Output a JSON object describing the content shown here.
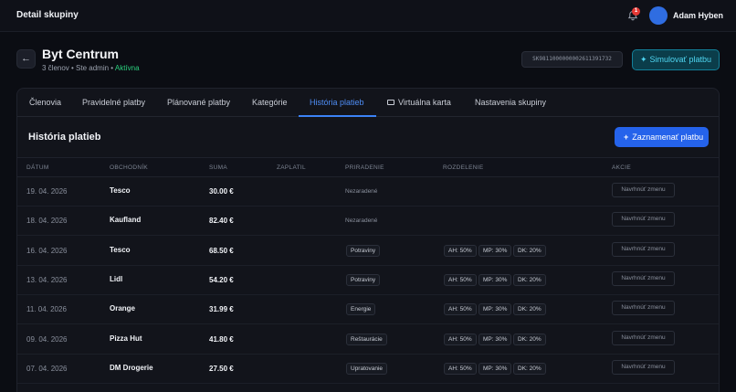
{
  "topbar": {
    "title": "Detail skupiny",
    "notification_count": "1",
    "user_name": "Adam Hyben"
  },
  "group": {
    "name": "Byt Centrum",
    "members": "3 členov • Ste admin • ",
    "status": "Aktívna",
    "iban": "SK9811000000002611391732",
    "simulate_label": "Simulovať platbu"
  },
  "tabs": [
    {
      "label": "Členovia"
    },
    {
      "label": "Pravidelné platby"
    },
    {
      "label": "Plánované platby"
    },
    {
      "label": "Kategórie"
    },
    {
      "label": "História platieb"
    },
    {
      "label": "Virtuálna karta"
    },
    {
      "label": "Nastavenia skupiny"
    }
  ],
  "section": {
    "title": "História platieb",
    "record_button": "Zaznamenať platbu"
  },
  "table": {
    "headers": [
      "DÁTUM",
      "OBCHODNÍK",
      "SUMA",
      "ZAPLATIL",
      "PRIRADENIE",
      "ROZDELENIE",
      "AKCIE"
    ],
    "action_label": "Navrhnúť zmenu",
    "rows": [
      {
        "date": "19. 04. 2026",
        "merchant": "Tesco",
        "amount": "30.00 €",
        "category": "Nezaradené",
        "splits": []
      },
      {
        "date": "18. 04. 2026",
        "merchant": "Kaufland",
        "amount": "82.40 €",
        "category": "Nezaradené",
        "splits": []
      },
      {
        "date": "16. 04. 2026",
        "merchant": "Tesco",
        "amount": "68.50 €",
        "category": "Potraviny",
        "splits": [
          "AH: 50%",
          "MP: 30%",
          "DK: 20%"
        ]
      },
      {
        "date": "13. 04. 2026",
        "merchant": "Lidl",
        "amount": "54.20 €",
        "category": "Potraviny",
        "splits": [
          "AH: 50%",
          "MP: 30%",
          "DK: 20%"
        ]
      },
      {
        "date": "11. 04. 2026",
        "merchant": "Orange",
        "amount": "31.99 €",
        "category": "Energie",
        "splits": [
          "AH: 50%",
          "MP: 30%",
          "DK: 20%"
        ]
      },
      {
        "date": "09. 04. 2026",
        "merchant": "Pizza Hut",
        "amount": "41.80 €",
        "category": "Reštaurácie",
        "splits": [
          "AH: 50%",
          "MP: 30%",
          "DK: 20%"
        ]
      },
      {
        "date": "07. 04. 2026",
        "merchant": "DM Drogerie",
        "amount": "27.50 €",
        "category": "Upratovanie",
        "splits": [
          "AH: 50%",
          "MP: 30%",
          "DK: 20%"
        ]
      }
    ]
  },
  "colors": {
    "background": "#0b0d13",
    "accent": "#3b82f6",
    "active_status": "#2bd17e",
    "simulate": "#4fd6f2",
    "notification": "#e53935"
  }
}
